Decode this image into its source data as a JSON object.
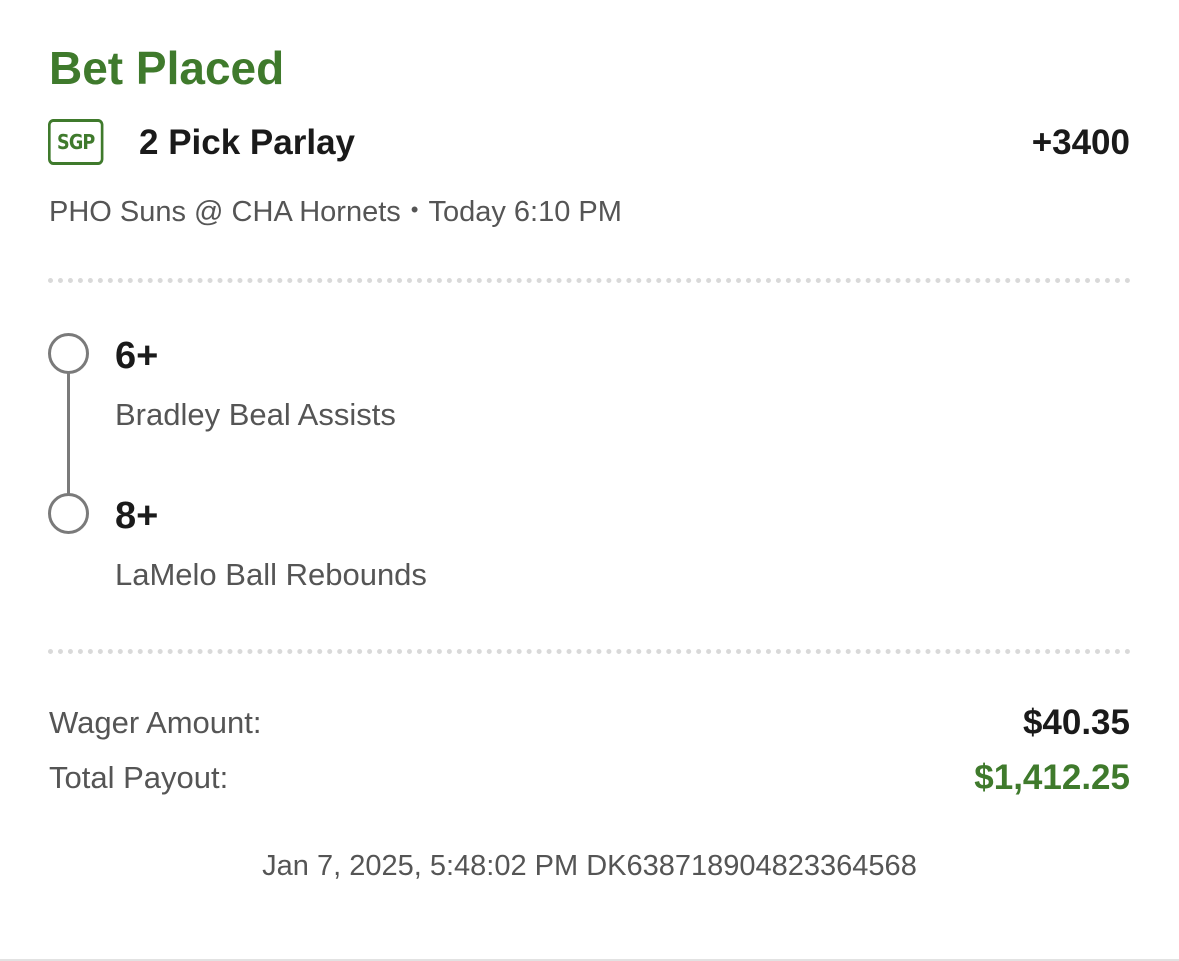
{
  "status": {
    "title": "Bet Placed"
  },
  "bet": {
    "badge": "SGP",
    "title": "2 Pick Parlay",
    "odds": "+3400",
    "game": "PHO Suns @ CHA Hornets",
    "separator": "•",
    "game_time": "Today 6:10 PM"
  },
  "legs": [
    {
      "line": "6+",
      "market": "Bradley Beal Assists"
    },
    {
      "line": "8+",
      "market": "LaMelo Ball Rebounds"
    }
  ],
  "summary": {
    "wager_label": "Wager Amount:",
    "wager_value": "$40.35",
    "payout_label": "Total Payout:",
    "payout_value": "$1,412.25"
  },
  "footer": {
    "placed_at": "Jan 7, 2025, 5:48:02 PM",
    "bet_id": "DK638718904823364568"
  },
  "colors": {
    "accent_green": "#3f7a2c",
    "text_primary": "#1a1a1a",
    "text_secondary": "#555555",
    "timeline_gray": "#7a7a7a"
  }
}
